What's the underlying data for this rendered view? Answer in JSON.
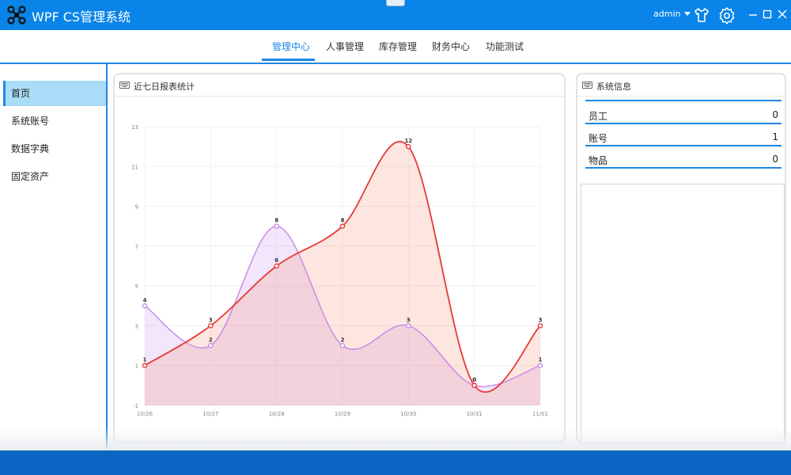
{
  "app": {
    "title": "WPF CS管理系统",
    "user": "admin",
    "logo_icon": "drone-icon",
    "header_icons": [
      "tshirt-icon",
      "gear-icon"
    ],
    "window_controls": [
      "minimize-icon",
      "maximize-icon",
      "close-icon"
    ]
  },
  "colors": {
    "titlebar": "#0a84e8",
    "accent": "#1e88e5",
    "series_purple": "#c98be8",
    "series_red": "#e53935",
    "statusbar": "#0a66c2"
  },
  "nav": {
    "tabs": [
      {
        "label": "管理中心",
        "active": true
      },
      {
        "label": "人事管理",
        "active": false
      },
      {
        "label": "库存管理",
        "active": false
      },
      {
        "label": "财务中心",
        "active": false
      },
      {
        "label": "功能测试",
        "active": false
      }
    ]
  },
  "sidebar": {
    "items": [
      {
        "label": "首页",
        "active": true
      },
      {
        "label": "系统账号",
        "active": false
      },
      {
        "label": "数据字典",
        "active": false
      },
      {
        "label": "固定资产",
        "active": false
      }
    ]
  },
  "report": {
    "title": "近七日报表统计",
    "icon": "keyboard-icon"
  },
  "chart_data": {
    "type": "area",
    "categories": [
      "10/26",
      "10/27",
      "10/28",
      "10/29",
      "10/30",
      "10/31",
      "11/01"
    ],
    "series": [
      {
        "values": [
          4,
          2,
          8,
          2,
          3,
          0,
          1
        ],
        "color": "#c98be8"
      },
      {
        "values": [
          1,
          3,
          6,
          8,
          12,
          0,
          3
        ],
        "color": "#e53935"
      }
    ],
    "yticks": [
      -1,
      1,
      3,
      5,
      7,
      9,
      11,
      13
    ],
    "ylim": [
      -1,
      13
    ],
    "grid": true,
    "smooth": true
  },
  "system_info": {
    "title": "系统信息",
    "icon": "keyboard-icon",
    "rows": [
      {
        "label": "员工",
        "value": "0"
      },
      {
        "label": "账号",
        "value": "1"
      },
      {
        "label": "物品",
        "value": "0"
      }
    ]
  }
}
